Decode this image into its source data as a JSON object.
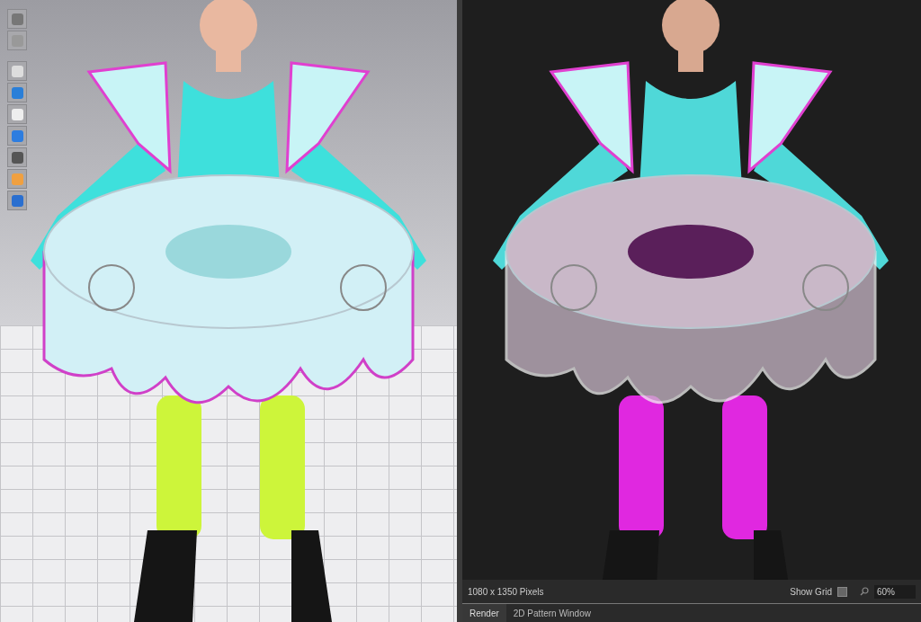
{
  "render_panel": {
    "image_size": "1080 x 1350 Pixels",
    "show_grid": {
      "label": "Show Grid",
      "checked": false
    },
    "zoom": {
      "value": "60%"
    }
  },
  "tabs": [
    {
      "label": "Render",
      "selected": true
    },
    {
      "label": "2D Pattern Window",
      "selected": false
    }
  ]
}
